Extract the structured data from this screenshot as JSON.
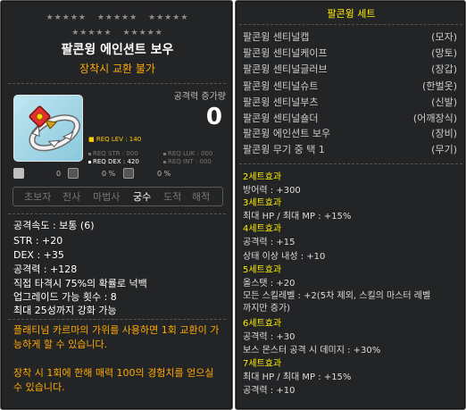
{
  "item": {
    "stars_row1": [
      "★★★★★",
      "★★★★★",
      "★★★★★"
    ],
    "stars_row2": [
      "★★★★★",
      "★★★★★"
    ],
    "name": "팔콘윙 에인션트 보우",
    "subtitle": "장착시 교환 불가",
    "attack_increase_label": "공격력 증가량",
    "attack_increase_value": "0",
    "req_lev": "REQ LEV : 140",
    "req_str": "REQ STR : 000",
    "req_luk": "REQ LUK : 000",
    "req_dex": "REQ DEX : 420",
    "req_int": "REQ INT : 000",
    "stat_icons": [
      {
        "icon": "arrow-icon",
        "value": "0"
      },
      {
        "icon": "box-icon",
        "value": "0 %"
      },
      {
        "icon": "shield-icon",
        "value": "0 %"
      }
    ],
    "jobs": [
      {
        "label": "초보자",
        "active": false
      },
      {
        "label": "전사",
        "active": false
      },
      {
        "label": "마법사",
        "active": false
      },
      {
        "label": "궁수",
        "active": true
      },
      {
        "label": "도적",
        "active": false
      },
      {
        "label": "해적",
        "active": false
      }
    ],
    "stats": [
      "공격속도 : 보통 (6)",
      "STR : +20",
      "DEX : +35",
      "공격력 : +128",
      "직접 타격시 75%의 확률로 넉백",
      "업그레이드 가능 횟수 : 8",
      "최대 25성까지 강화 가능"
    ],
    "notes": [
      "플래티넘 카르마의 가위를 사용하면 1회 교환이 가능하게 할 수 있습니다.",
      "장착 시 1회에 한해 매력 100의 경험치를 얻으실 수 있습니다."
    ]
  },
  "set": {
    "title": "팔콘윙 세트",
    "items": [
      {
        "name": "팔콘윙 센티널캡",
        "type": "(모자)"
      },
      {
        "name": "팔콘윙 센티널케이프",
        "type": "(망토)"
      },
      {
        "name": "팔콘윙 센티널글러브",
        "type": "(장갑)"
      },
      {
        "name": "팔콘윙 센티널슈트",
        "type": "(한벌옷)"
      },
      {
        "name": "팔콘윙 센티널부츠",
        "type": "(신발)"
      },
      {
        "name": "팔콘윙 센티널숄더",
        "type": "(어깨장식)"
      },
      {
        "name": "팔콘윙 에인션트 보우",
        "type": "(장비)"
      },
      {
        "name": "팔콘윙 무기 중 택 1",
        "type": "(무기)"
      }
    ],
    "effects": [
      {
        "header": "2세트효과",
        "lines": [
          "방어력 : +300"
        ]
      },
      {
        "header": "3세트효과",
        "lines": [
          "최대 HP / 최대 MP : +15%"
        ]
      },
      {
        "header": "4세트효과",
        "lines": [
          "공격력 : +15",
          "상태 이상 내성 : +10"
        ]
      },
      {
        "header": "5세트효과",
        "lines": [
          "올스탯 : +20",
          "모든 스킬레벨 : +2(5차 제외, 스킬의 마스터 레벨",
          "까지만 증가)"
        ]
      },
      {
        "header": "6세트효과",
        "lines": [
          "공격력 : +30",
          "보스 몬스터 공격 시 데미지 : +30%"
        ]
      },
      {
        "header": "7세트효과",
        "lines": [
          "최대 HP / 최대 MP : +15%",
          "공격력 : +10"
        ]
      }
    ]
  },
  "colors": {
    "panel_bg": "#232426",
    "item_name": "#ffffff",
    "subtitle": "#ffaa00",
    "req_level": "#ffcc00",
    "set_title": "#ffee00",
    "note_text": "#ffaa00"
  }
}
